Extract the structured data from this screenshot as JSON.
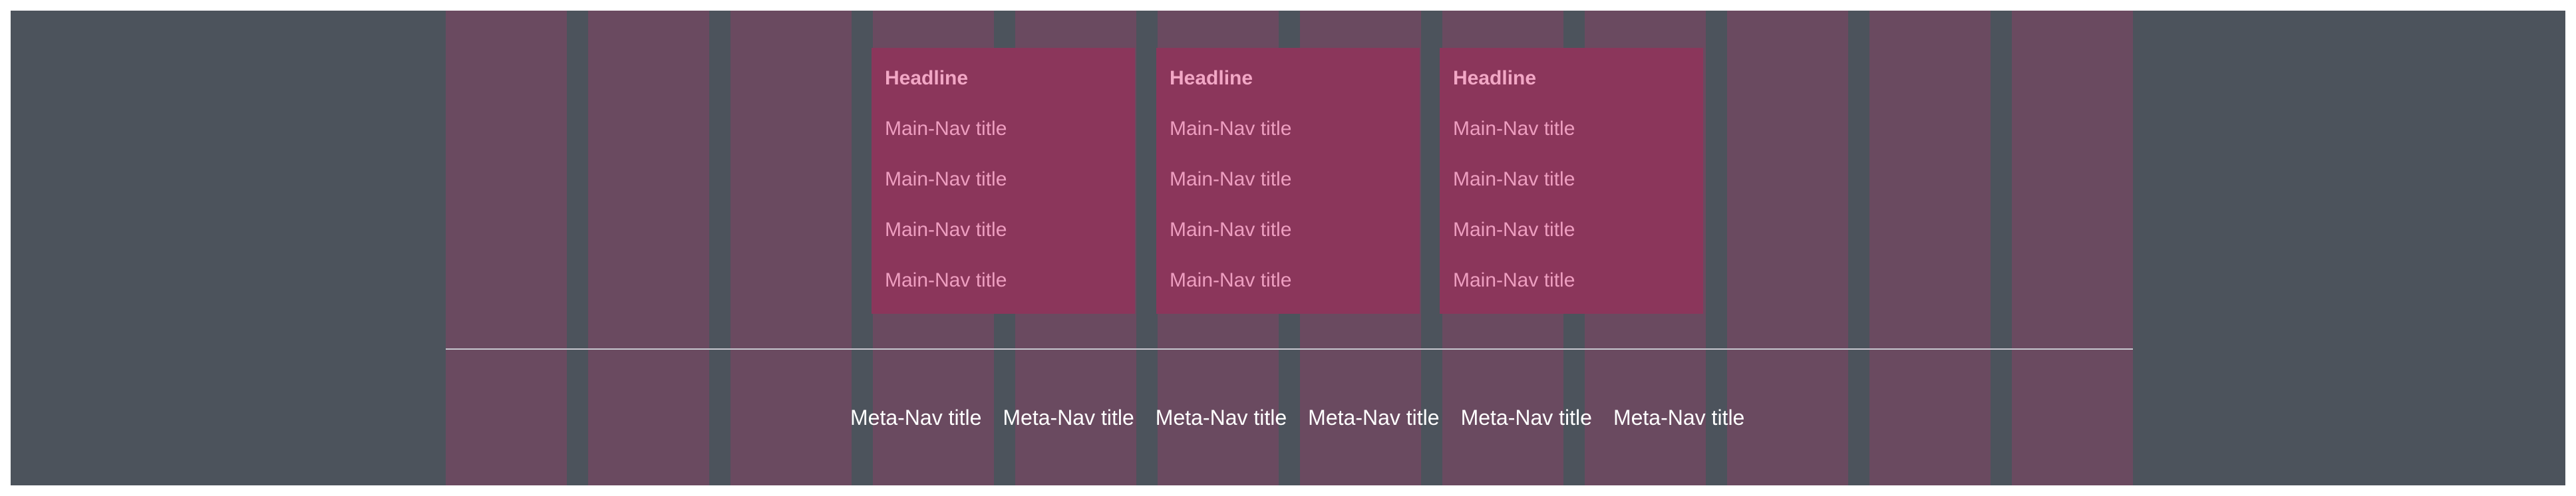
{
  "main_nav": {
    "groups": [
      {
        "headline": "Headline",
        "items": [
          "Main-Nav title",
          "Main-Nav title",
          "Main-Nav title",
          "Main-Nav title"
        ]
      },
      {
        "headline": "Headline",
        "items": [
          "Main-Nav title",
          "Main-Nav title",
          "Main-Nav title",
          "Main-Nav title"
        ]
      },
      {
        "headline": "Headline",
        "items": [
          "Main-Nav title",
          "Main-Nav title",
          "Main-Nav title",
          "Main-Nav title"
        ]
      }
    ]
  },
  "meta_nav": {
    "items": [
      "Meta-Nav title",
      "Meta-Nav title",
      "Meta-Nav title",
      "Meta-Nav title",
      "Meta-Nav title",
      "Meta-Nav title"
    ]
  },
  "colors": {
    "background": "#4c535c",
    "grid_column": "#6a4a60",
    "nav_group": "#8b365b",
    "headline": "#f2a7c5",
    "nav_item": "#ee9ec0",
    "divider": "#c8c8d0",
    "meta_item": "#ffffff"
  }
}
